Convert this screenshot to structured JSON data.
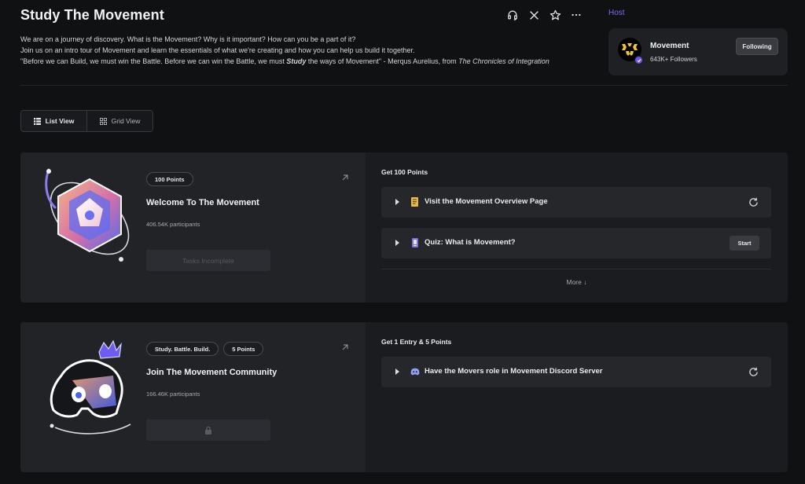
{
  "page": {
    "title": "Study The Movement",
    "description": [
      "We are on a journey of discovery. What is the Movement? Why is it important? How can you be a part of it?",
      "Join us on an intro tour of Movement and learn the essentials of what we're creating and how you can help us build it together."
    ],
    "quote": {
      "part1": "\"Before we can Build, we must win the Battle. Before we can win the Battle, we must ",
      "emphasis": "Study",
      "part2": " the ways of Movement\" - Merqus Aurelius, from ",
      "source": "The Chronicles of Integration"
    }
  },
  "top_icons": [
    "headset-icon",
    "x-logo-icon",
    "star-icon",
    "more-icon"
  ],
  "host": {
    "label": "Host",
    "name": "Movement",
    "followers": "643K+ Followers",
    "follow_label": "Following"
  },
  "view_toggle": {
    "list_label": "List View",
    "grid_label": "Grid View",
    "active": "list"
  },
  "quests": [
    {
      "badges": [
        "100 Points"
      ],
      "title": "Welcome To The Movement",
      "participants": "406.54K participants",
      "button_label": "Tasks Incomplete",
      "reward_label": "Get 100 Points",
      "tasks": [
        {
          "label": "Visit the Movement Overview Page",
          "icon": "document-icon",
          "action": "refresh"
        },
        {
          "label": "Quiz: What is Movement?",
          "icon": "quiz-icon",
          "action": "start",
          "action_label": "Start"
        }
      ],
      "more_label": "More ↓"
    },
    {
      "badges": [
        "Study. Battle. Build.",
        "5 Points"
      ],
      "title": "Join The Movement Community",
      "participants": "166.46K participants",
      "button_label": "",
      "reward_label": "Get 1 Entry & 5 Points",
      "tasks": [
        {
          "label": "Have the Movers role in Movement Discord Server",
          "icon": "discord-icon",
          "action": "refresh"
        }
      ]
    }
  ],
  "colors": {
    "background": "#101113",
    "card_left": "#222327",
    "card_right": "#1b1c1f",
    "accent_purple": "#7b6cf6",
    "art_orange": "#f0a07a",
    "art_blue": "#5a7cf5"
  }
}
